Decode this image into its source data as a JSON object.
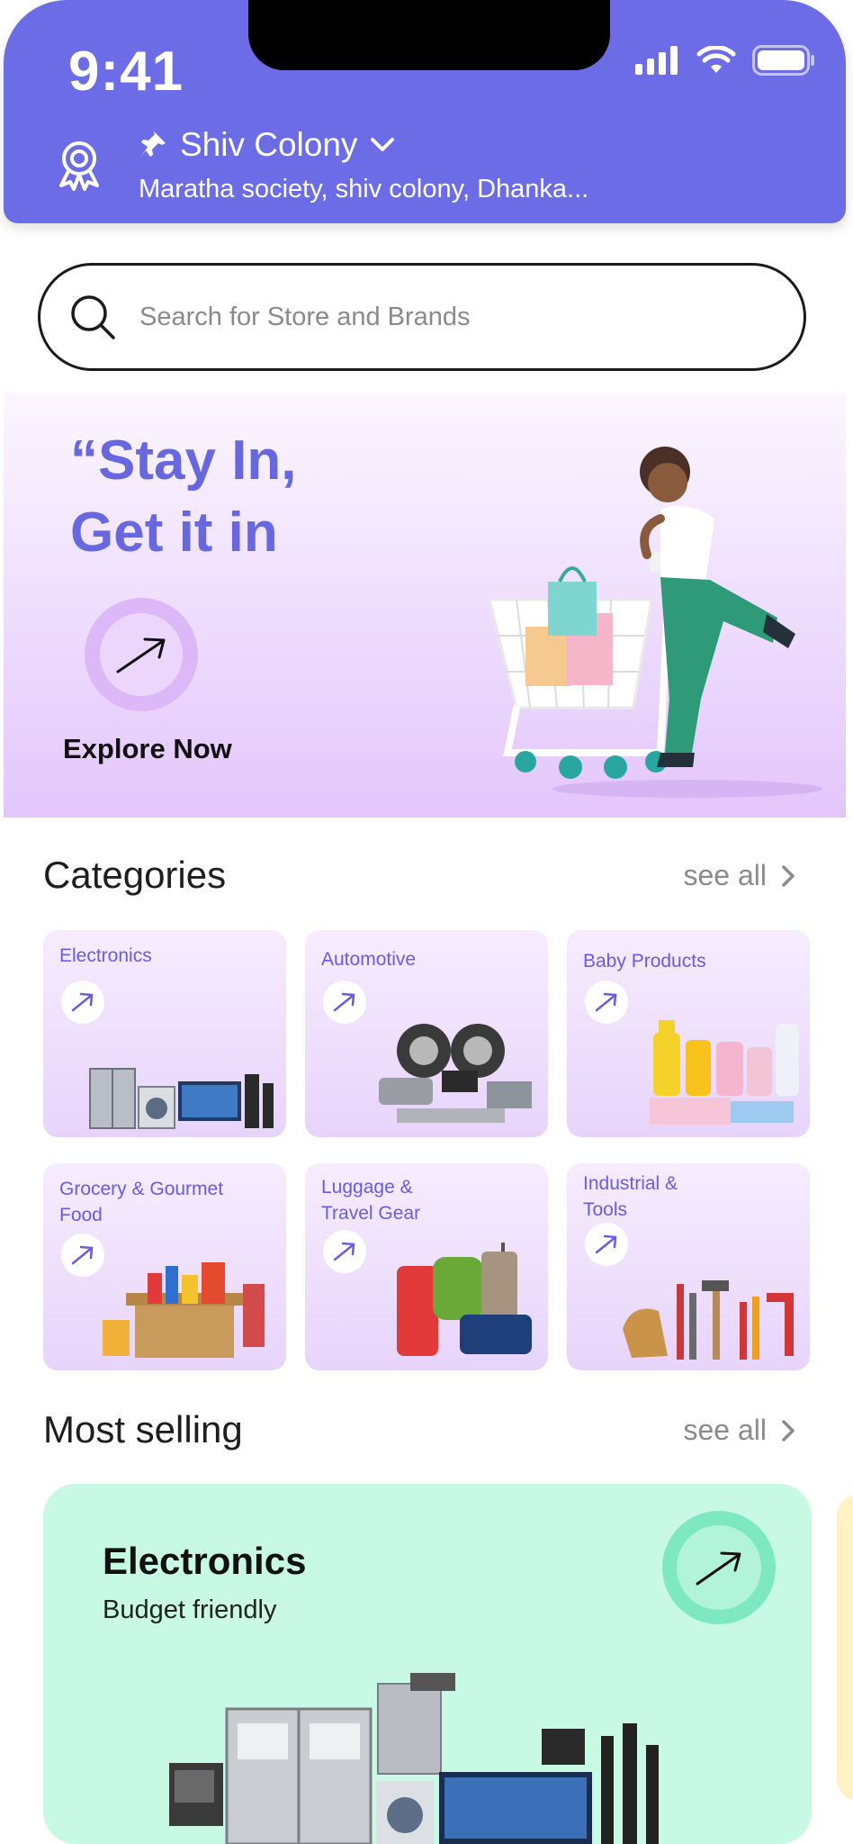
{
  "status_bar": {
    "time": "9:41"
  },
  "location": {
    "title": "Shiv Colony",
    "address": "Maratha society, shiv colony, Dhanka..."
  },
  "search": {
    "placeholder": "Search for Store and Brands"
  },
  "hero": {
    "line1": "“Stay In,",
    "line2": "Get it in",
    "cta": "Explore Now"
  },
  "categories": {
    "title": "Categories",
    "see_all": "see all",
    "items": [
      {
        "label": "Electronics"
      },
      {
        "label": "Automotive"
      },
      {
        "label": "Baby Products"
      },
      {
        "label": "Grocery & Gourmet Food"
      },
      {
        "label": "Luggage & Travel Gear"
      },
      {
        "label": "Industrial & Tools"
      }
    ]
  },
  "most_selling": {
    "title": "Most selling",
    "see_all": "see all",
    "card": {
      "title": "Electronics",
      "subtitle": "Budget friendly"
    }
  },
  "colors": {
    "brand": "#6c6ce6",
    "hero_text": "#6767e0",
    "card_bg": "#efe0fd",
    "most_selling_bg": "#c8f9e4"
  }
}
